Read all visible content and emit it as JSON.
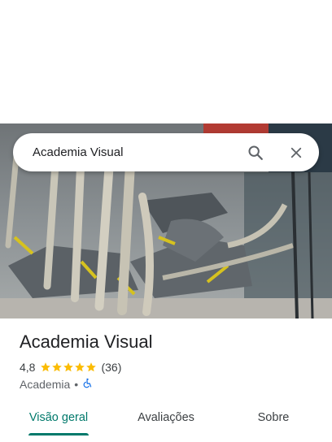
{
  "search": {
    "query": "Academia Visual"
  },
  "place": {
    "name": "Academia Visual",
    "rating": "4,8",
    "review_count": "(36)",
    "star_count": 5,
    "category": "Academia",
    "separator": "•",
    "accessibility_icon": "wheelchair-icon"
  },
  "tabs": [
    {
      "label": "Visão geral",
      "active": true
    },
    {
      "label": "Avaliações",
      "active": false
    },
    {
      "label": "Sobre",
      "active": false
    }
  ],
  "colors": {
    "accent": "#00796b",
    "star": "#fbbc04",
    "accessibility": "#1a73e8"
  }
}
